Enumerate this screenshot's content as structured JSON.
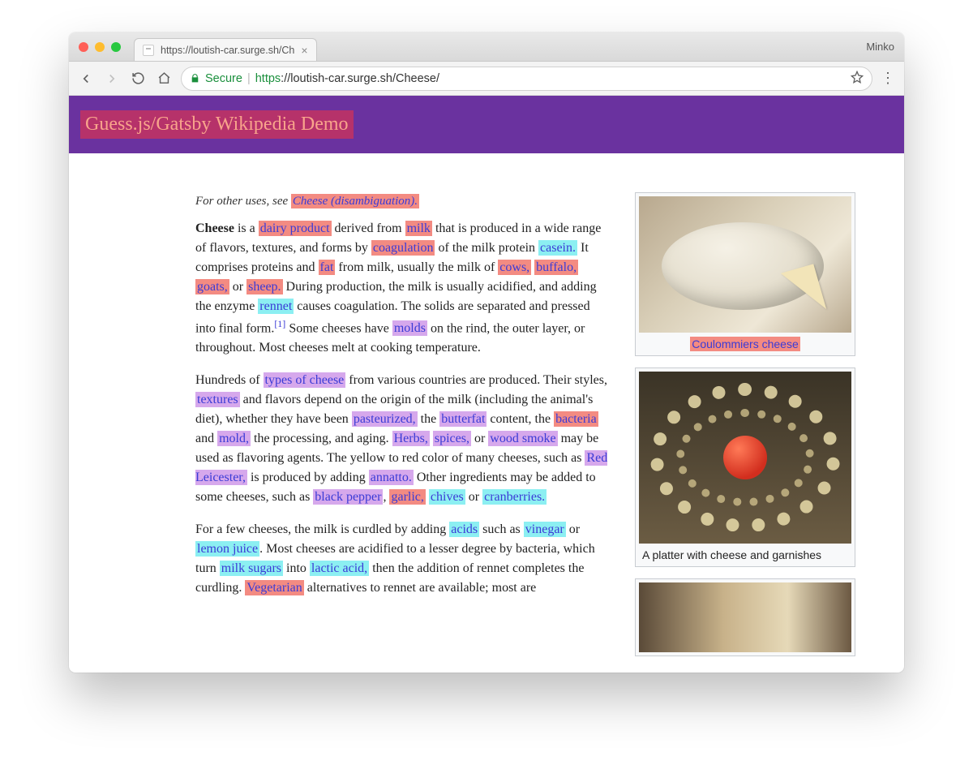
{
  "browser": {
    "tab_title": "https://loutish-car.surge.sh/Ch",
    "profile_name": "Minko",
    "secure_label": "Secure",
    "url_scheme": "https",
    "url_rest": "://loutish-car.surge.sh/Cheese/"
  },
  "header": {
    "title": "Guess.js/Gatsby Wikipedia Demo"
  },
  "hatnote": {
    "prefix": "For other uses, see ",
    "link": "Cheese (disambiguation)."
  },
  "p1": {
    "bold": "Cheese",
    "t1": " is a ",
    "dairy_product": "dairy product",
    "t2": " derived from ",
    "milk": "milk",
    "t3": " that is produced in a wide range of flavors, textures, and forms by ",
    "coagulation": "coagulation",
    "t4": " of the milk protein ",
    "casein": "casein.",
    "t5": " It comprises proteins and ",
    "fat": "fat",
    "t6": " from milk, usually the milk of ",
    "cows": "cows,",
    "buffalo": "buffalo,",
    "goats": "goats,",
    "t7": " or ",
    "sheep": "sheep.",
    "t8": " During production, the milk is usually acidified, and adding the enzyme ",
    "rennet": "rennet",
    "t9": " causes coagulation. The solids are separated and pressed into final form.",
    "ref": "[1]",
    "t10": " Some cheeses have ",
    "molds": "molds",
    "t11": " on the rind, the outer layer, or throughout. Most cheeses melt at cooking temperature."
  },
  "p2": {
    "t1": "Hundreds of ",
    "types": "types of cheese",
    "t2": " from various countries are produced. Their styles, ",
    "textures": "textures",
    "t3": " and flavors depend on the origin of the milk (including the animal's diet), whether they have been ",
    "pasteurized": "pasteurized,",
    "t4": " the ",
    "butterfat": "butterfat",
    "t5": " content, the ",
    "bacteria": "bacteria",
    "t6": " and ",
    "mold": "mold,",
    "t7": " the processing, and aging. ",
    "herbs": "Herbs,",
    "spices": "spices,",
    "t8": " or ",
    "wood_smoke": "wood smoke",
    "t9": " may be used as flavoring agents. The yellow to red color of many cheeses, such as ",
    "red_leicester": "Red Leicester,",
    "t10": " is produced by adding ",
    "annatto": "annatto.",
    "t11": " Other ingredients may be added to some cheeses, such as ",
    "black_pepper": "black pepper",
    "t12": ", ",
    "garlic": "garlic,",
    "chives": "chives",
    "t13": " or ",
    "cranberries": "cranberries."
  },
  "p3": {
    "t1": "For a few cheeses, the milk is curdled by adding ",
    "acids": "acids",
    "t2": " such as ",
    "vinegar": "vinegar",
    "t3": " or ",
    "lemon_juice": "lemon juice",
    "t4": ". Most cheeses are acidified to a lesser degree by bacteria, which turn ",
    "milk_sugars": "milk sugars",
    "t5": " into ",
    "lactic_acid": "lactic acid,",
    "t6": " then the addition of rennet completes the curdling. ",
    "vegetarian": "Vegetarian",
    "t7": " alternatives to rennet are available; most are"
  },
  "figures": {
    "f1_caption": "Coulommiers cheese",
    "f2_caption": "A platter with cheese and garnishes"
  }
}
